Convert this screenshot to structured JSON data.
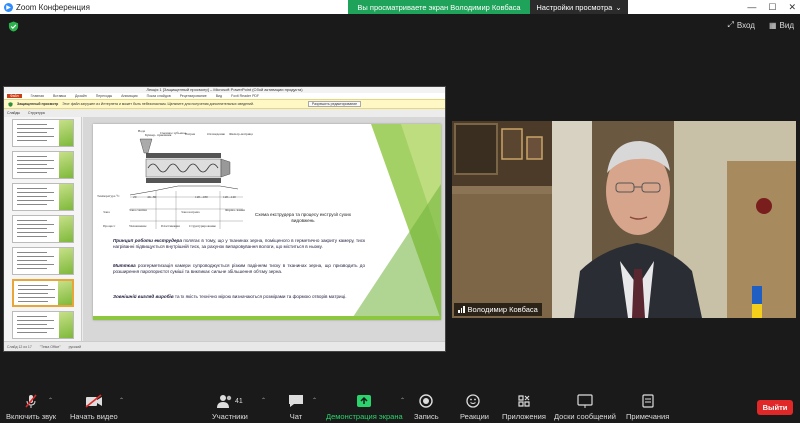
{
  "window": {
    "title": "Zoom Конференция",
    "share_banner": "Вы просматриваете экран Володимир Ковбаса",
    "view_options": "Настройки просмотра",
    "top_right": {
      "enter": "Вход",
      "view": "Вид"
    }
  },
  "shared_screen": {
    "app_title": "Лекція 1 [Защищенный просмотр] – Microsoft PowerPoint (Сбой активации продукта)",
    "menu": [
      "Файл",
      "Главная",
      "Вставка",
      "Дизайн",
      "Переходы",
      "Анимация",
      "Показ слайдов",
      "Рецензирование",
      "Вид",
      "Foxit Reader PDF"
    ],
    "warning": {
      "label": "Защищенный просмотр",
      "text": "Этот файл загружен из Интернета и может быть небезопасным. Щелкните для получения дополнительных сведений.",
      "button": "Разрешить редактирование"
    },
    "panel_tabs": [
      "Слайды",
      "Структура"
    ],
    "thumb_numbers": [
      "7",
      "8",
      "9",
      "10",
      "11",
      "12",
      "13"
    ],
    "status": [
      "Слайд 12 из 17",
      "\"Тема Office\"",
      "русский"
    ],
    "slide": {
      "diagram_labels": {
        "top": [
          "Вода",
          "Бункер-\nприемник",
          "Сменное\nзубьевое",
          "Нагрев",
          "Охлаждение",
          "Фильтр-матрица"
        ],
        "left": [
          "Температура °С",
          "Зона",
          "Процесс"
        ],
        "temps": [
          "20",
          "40...80",
          "120...180",
          "120...140"
        ],
        "zones": [
          "Зона\nсжатия",
          "Зона\nнагрева",
          "Форма-\nвания"
        ],
        "process": [
          "Увлажнение",
          "Пластикация",
          "Структурирование"
        ]
      },
      "caption": "Схема екструдера та процесу екструзії сухих видовжень",
      "para1_lead": "Принцип роботи екструдера",
      "para1": "полягає в тому, що у тканинах зерна, поміщеного в герметично закриту камеру, тиск нагріванні підвищується внутрішній тиск, за рахунок випаровування вологи, що міститься в ньому.",
      "para2_lead": "Миттєва",
      "para2": "розгерметизація камери супроводжується різким падінням тиску в тканинах зерна, що призводить до розширення паропористої суміші та викликає сильне збільшення об'єму зерна.",
      "para3_lead": "Зовнішній вигляд виробів",
      "para3": "та їх якість технічно мірою визначаються розмірами та формою отворів матриці."
    }
  },
  "camera": {
    "name": "Володимир Ковбаса"
  },
  "toolbar": {
    "mute": "Включить звук",
    "video": "Начать видео",
    "participants": "Участники",
    "participants_count": "41",
    "chat": "Чат",
    "share": "Демонстрация экрана",
    "record": "Запись",
    "reactions": "Реакции",
    "apps": "Приложения",
    "whiteboard": "Доски сообщений",
    "notes": "Примечания",
    "exit": "Выйти"
  },
  "colors": {
    "share_green": "#1fa35a",
    "exit_red": "#e02828",
    "slide_green": "#8dc63f",
    "zoom_blue": "#2d8cff"
  }
}
